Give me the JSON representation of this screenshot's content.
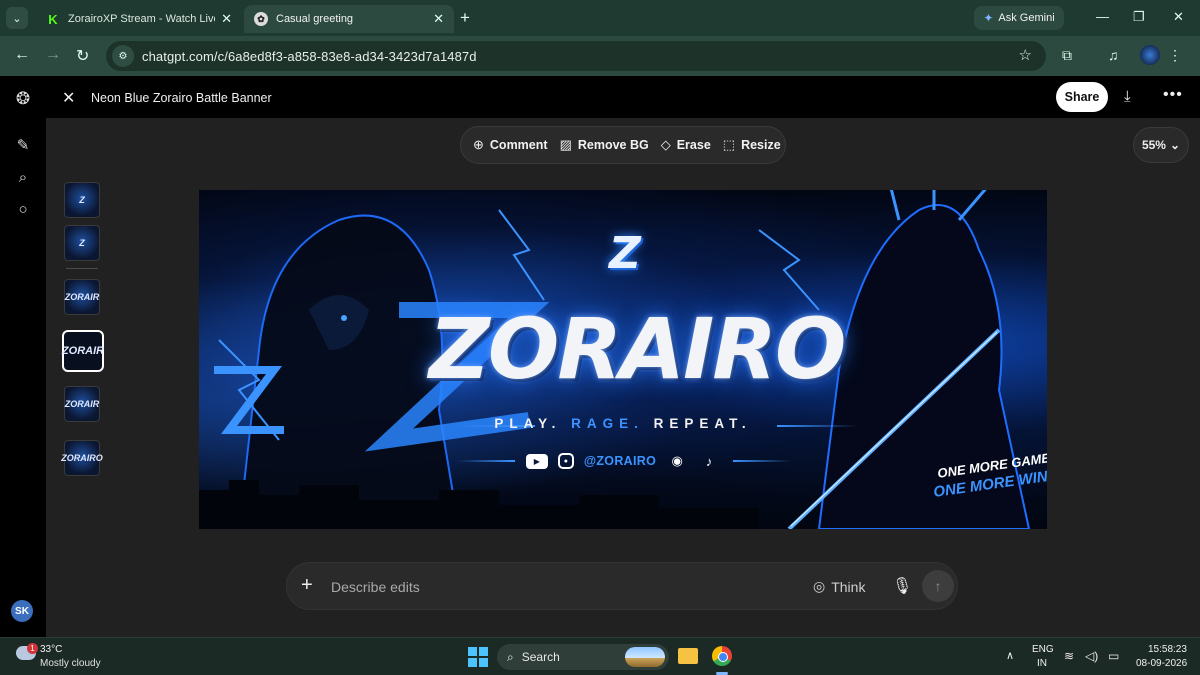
{
  "browser": {
    "tabs": [
      {
        "title": "ZorairoXP Stream - Watch Live on",
        "favicon": "kick-icon"
      },
      {
        "title": "Casual greeting",
        "favicon": "chatgpt-icon"
      }
    ],
    "gemini_label": "Ask Gemini",
    "url": "chatgpt.com/c/6a8ed8f3-a858-83e8-ad34-3423d7a1487d"
  },
  "app": {
    "title": "Neon Blue Zorairo Battle Banner",
    "share_label": "Share",
    "avatar_initials": "SK",
    "tools": [
      {
        "label": "Comment",
        "icon": "comment-plus-icon"
      },
      {
        "label": "Remove BG",
        "icon": "remove-bg-icon"
      },
      {
        "label": "Erase",
        "icon": "eraser-icon"
      },
      {
        "label": "Resize",
        "icon": "resize-icon"
      }
    ],
    "zoom": "55%",
    "thumbnails": [
      "Z",
      "Z",
      "ZORAIR",
      "ZORAIR",
      "ZORAIR",
      "ZORAIRO"
    ],
    "prompt_placeholder": "Describe edits",
    "think_label": "Think"
  },
  "banner": {
    "brand": "ZORAIRO",
    "small_mark": "Z",
    "tagline_1": "PLAY.",
    "tagline_2": "RAGE.",
    "tagline_3": "REPEAT.",
    "handle": "@ZORAIRO",
    "slogan_1": "ONE MORE GAME",
    "slogan_2": "ONE MORE WIN",
    "accent": "#3b93ff"
  },
  "taskbar": {
    "temperature": "33°C",
    "condition": "Mostly cloudy",
    "weather_badge": "1",
    "search_label": "Search",
    "lang_1": "ENG",
    "lang_2": "IN",
    "time": "15:58:23",
    "date": "08-09-2026"
  }
}
